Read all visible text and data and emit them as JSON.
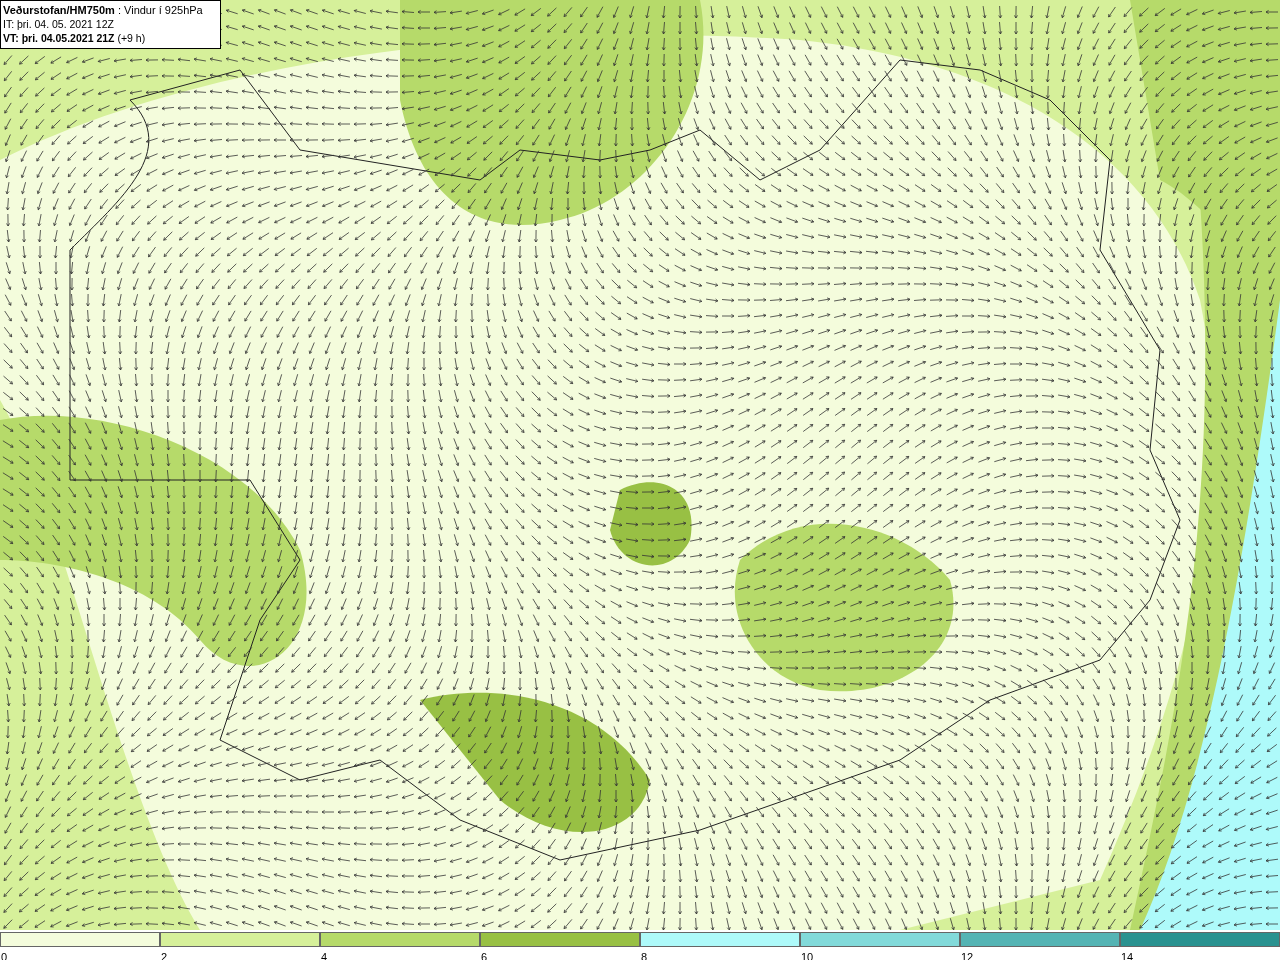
{
  "info_box": {
    "lines": [
      "**Veðurstofan/HM750m** : Vindur í 925hPa",
      "IT: þri. 04. 05. 2021 12Z",
      "**VT: þri. 04.05.2021 21Z** (+9 h)"
    ]
  },
  "legend": {
    "bins": [
      {
        "label": "0",
        "color": "#f4fcdc"
      },
      {
        "label": "2",
        "color": "#d6f09a"
      },
      {
        "label": "4",
        "color": "#b6da6a"
      },
      {
        "label": "6",
        "color": "#98c044"
      },
      {
        "label": "8",
        "color": "#aefafa"
      },
      {
        "label": "10",
        "color": "#82dada"
      },
      {
        "label": "12",
        "color": "#54b4b4"
      },
      {
        "label": "14",
        "color": "#2a9290"
      }
    ]
  }
}
